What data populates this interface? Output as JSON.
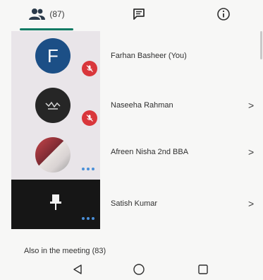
{
  "tabs": {
    "people": {
      "icon": "people-icon",
      "count": "(87)"
    },
    "chat": {
      "icon": "chat-icon"
    },
    "info": {
      "icon": "info-icon"
    }
  },
  "participants": [
    {
      "name": "Farhan Basheer (You)",
      "avatar_letter": "F",
      "muted": true,
      "has_chevron": false
    },
    {
      "name": "Naseeha Rahman",
      "muted": true,
      "has_chevron": true,
      "chevron": ">"
    },
    {
      "name": "Afreen Nisha 2nd BBA",
      "muted": false,
      "has_chevron": true,
      "chevron": ">"
    },
    {
      "name": "Satish Kumar",
      "muted": false,
      "pinned": true,
      "has_chevron": true,
      "chevron": ">"
    }
  ],
  "section": {
    "label": "Also in the meeting (83)"
  },
  "navbar": {
    "icons": [
      "back-triangle-icon",
      "home-circle-icon",
      "recents-square-icon"
    ]
  },
  "colors": {
    "accent": "#0f7a64",
    "mute_badge": "#d9363b",
    "avatar_blue": "#1c4f86",
    "dots_blue": "#4a8fd8"
  }
}
